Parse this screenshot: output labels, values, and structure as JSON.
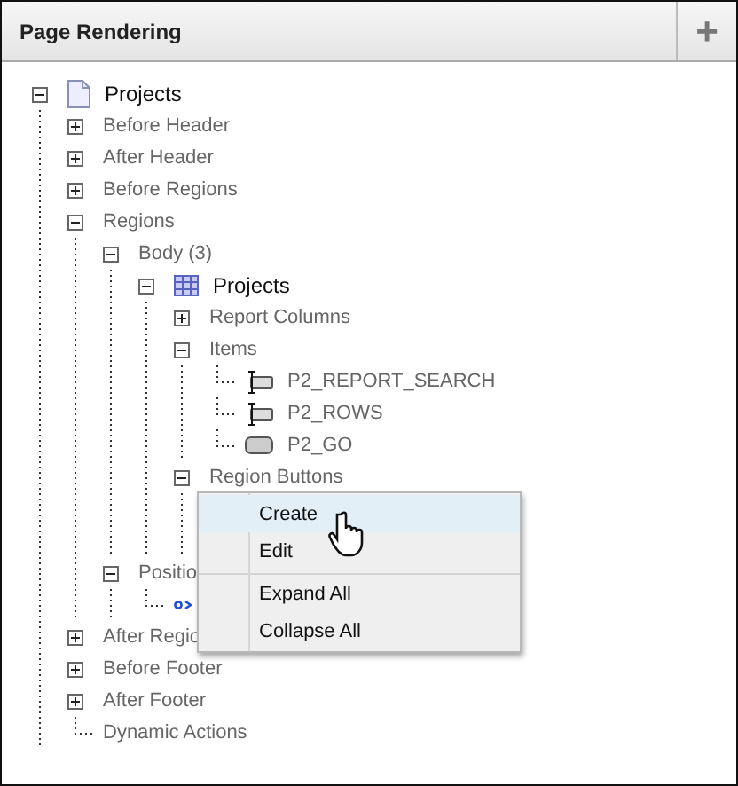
{
  "panel": {
    "title": "Page Rendering",
    "add_button": "+"
  },
  "tree": [
    {
      "label": "Projects",
      "kind": "page",
      "expanded": true,
      "children": [
        {
          "label": "Before Header",
          "expanded": false
        },
        {
          "label": "After Header",
          "expanded": false
        },
        {
          "label": "Before Regions",
          "expanded": false
        },
        {
          "label": "Regions",
          "expanded": true,
          "children": [
            {
              "label": "Body (3)",
              "expanded": true,
              "children": [
                {
                  "label": "Projects",
                  "kind": "region",
                  "expanded": true,
                  "children": [
                    {
                      "label": "Report Columns",
                      "expanded": false
                    },
                    {
                      "label": "Items",
                      "expanded": true,
                      "children": [
                        {
                          "label": "P2_REPORT_SEARCH",
                          "kind": "text-item"
                        },
                        {
                          "label": "P2_ROWS",
                          "kind": "text-item"
                        },
                        {
                          "label": "P2_GO",
                          "kind": "button-item"
                        }
                      ]
                    },
                    {
                      "label": "Region Buttons",
                      "expanded": true
                    }
                  ]
                }
              ]
            },
            {
              "label": "Positio",
              "expanded": true,
              "children": [
                {
                  "kind": "link"
                }
              ]
            }
          ]
        },
        {
          "label": "After Regio",
          "expanded": false
        },
        {
          "label": "Before Footer",
          "expanded": false
        },
        {
          "label": "After Footer",
          "expanded": false
        },
        {
          "label": "Dynamic Actions"
        }
      ]
    }
  ],
  "context_menu": {
    "items": [
      {
        "label": "Create",
        "highlighted": true,
        "separator_before": false
      },
      {
        "label": "Edit",
        "highlighted": false,
        "separator_before": false
      },
      {
        "label": "Expand All",
        "highlighted": false,
        "separator_before": true
      },
      {
        "label": "Collapse All",
        "highlighted": false,
        "separator_before": false
      }
    ]
  }
}
